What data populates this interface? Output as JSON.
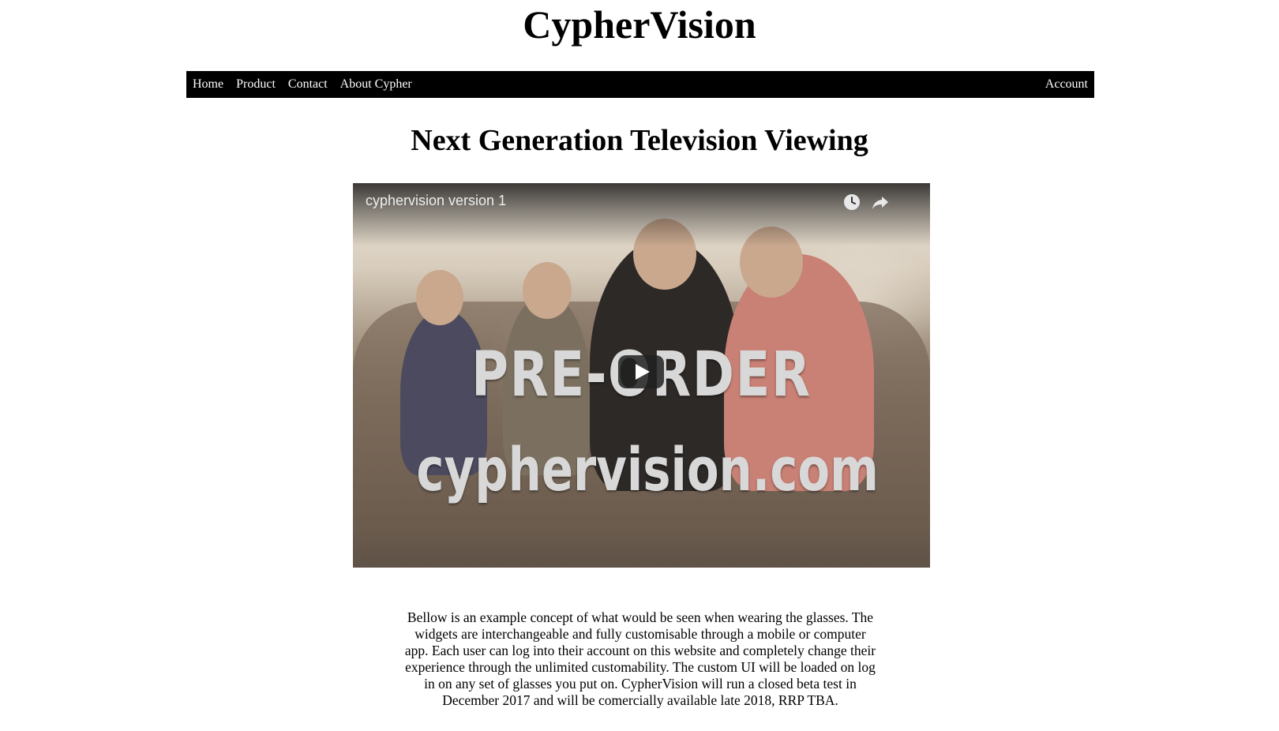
{
  "site": {
    "title": "CypherVision"
  },
  "nav": {
    "items": [
      {
        "label": "Home"
      },
      {
        "label": "Product"
      },
      {
        "label": "Contact"
      },
      {
        "label": "About Cypher"
      }
    ],
    "account_label": "Account"
  },
  "main": {
    "headline": "Next Generation Television Viewing",
    "video": {
      "title": "cyphervision version 1",
      "overlay_line1": "PRE-ORDER",
      "overlay_line2": "cyphervision.com",
      "icons": [
        "clock-icon",
        "share-icon",
        "play-icon"
      ]
    },
    "description": "Bellow is an example concept of what would be seen when wearing the glasses. The widgets are interchangeable and fully customisable through a mobile or computer app. Each user can log into their account on this website and completely change their experience through the unlimited customability. The custom UI will be loaded on log in on any set of glasses you put on. CypherVision will run a closed beta test in December 2017 and will be comercially available late 2018, RRP TBA."
  },
  "colors": {
    "nav_background": "#000000",
    "nav_text": "#ffffff",
    "page_background": "#ffffff"
  }
}
